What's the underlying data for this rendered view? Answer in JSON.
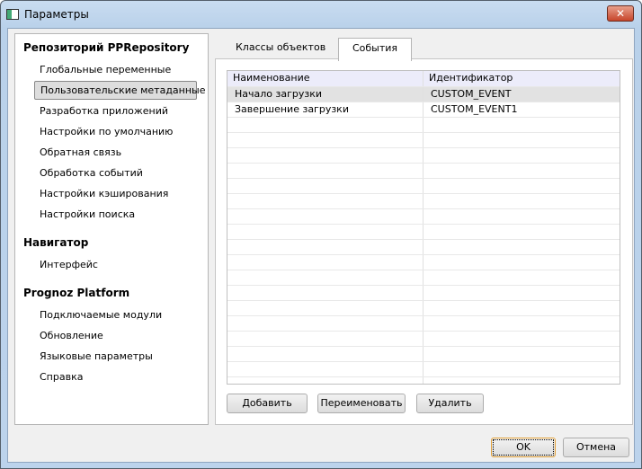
{
  "window": {
    "title": "Параметры",
    "close": "✕"
  },
  "sidebar": {
    "groups": [
      {
        "title": "Репозиторий PPRepository",
        "items": [
          "Глобальные переменные",
          "Пользовательские метаданные",
          "Разработка приложений",
          "Настройки по умолчанию",
          "Обратная связь",
          "Обработка событий",
          "Настройки кэширования",
          "Настройки поиска"
        ]
      },
      {
        "title": "Навигатор",
        "items": [
          "Интерфейс"
        ]
      },
      {
        "title": "Prognoz Platform",
        "items": [
          "Подключаемые модули",
          "Обновление",
          "Языковые параметры",
          "Справка"
        ]
      }
    ],
    "selected": "Пользовательские метаданные"
  },
  "tabs": [
    "Классы объектов",
    "События"
  ],
  "active_tab": "События",
  "table": {
    "columns": [
      "Наименование",
      "Идентификатор"
    ],
    "rows": [
      [
        "Начало загрузки",
        "CUSTOM_EVENT"
      ],
      [
        "Завершение загрузки",
        "CUSTOM_EVENT1"
      ]
    ]
  },
  "buttons": {
    "add": "Добавить",
    "rename": "Переименовать",
    "delete": "Удалить",
    "ok": "OK",
    "cancel": "Отмена"
  }
}
